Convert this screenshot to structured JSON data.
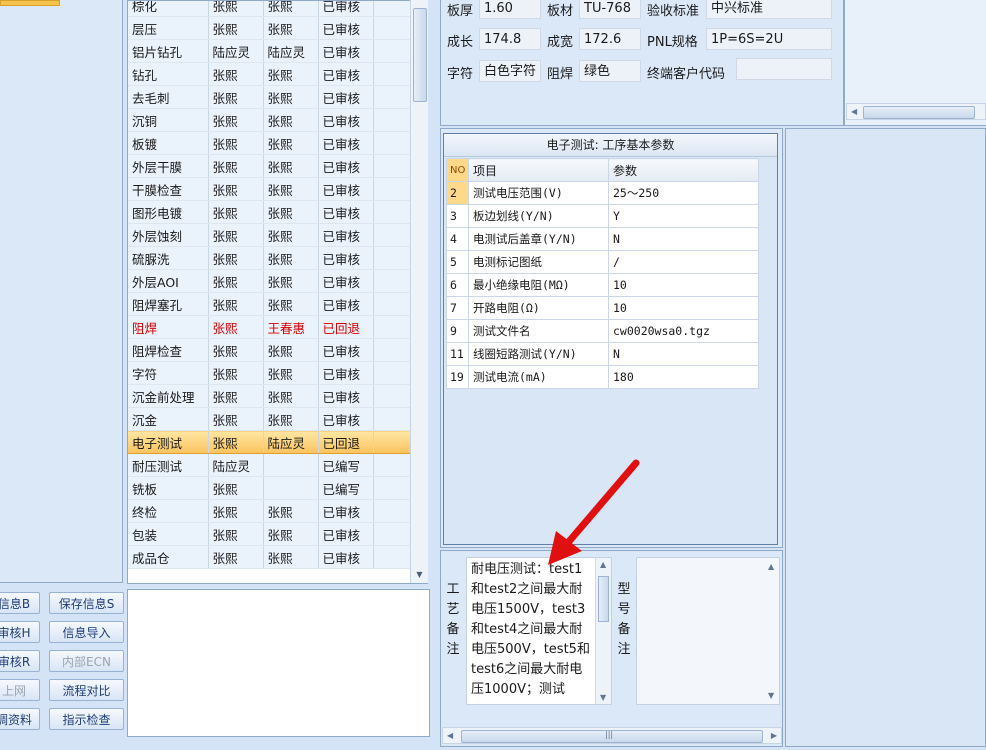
{
  "process_rows": [
    {
      "step": "棕化",
      "col2": "张熙",
      "col3": "张熙",
      "status": "已审核"
    },
    {
      "step": "层压",
      "col2": "张熙",
      "col3": "张熙",
      "status": "已审核"
    },
    {
      "step": "铝片钻孔",
      "col2": "陆应灵",
      "col3": "陆应灵",
      "status": "已审核"
    },
    {
      "step": "钻孔",
      "col2": "张熙",
      "col3": "张熙",
      "status": "已审核"
    },
    {
      "step": "去毛刺",
      "col2": "张熙",
      "col3": "张熙",
      "status": "已审核"
    },
    {
      "step": "沉铜",
      "col2": "张熙",
      "col3": "张熙",
      "status": "已审核"
    },
    {
      "step": "板镀",
      "col2": "张熙",
      "col3": "张熙",
      "status": "已审核"
    },
    {
      "step": "外层干膜",
      "col2": "张熙",
      "col3": "张熙",
      "status": "已审核"
    },
    {
      "step": "干膜检查",
      "col2": "张熙",
      "col3": "张熙",
      "status": "已审核"
    },
    {
      "step": "图形电镀",
      "col2": "张熙",
      "col3": "张熙",
      "status": "已审核"
    },
    {
      "step": "外层蚀刻",
      "col2": "张熙",
      "col3": "张熙",
      "status": "已审核"
    },
    {
      "step": "硫脲洗",
      "col2": "张熙",
      "col3": "张熙",
      "status": "已审核"
    },
    {
      "step": "外层AOI",
      "col2": "张熙",
      "col3": "张熙",
      "status": "已审核"
    },
    {
      "step": "阻焊塞孔",
      "col2": "张熙",
      "col3": "张熙",
      "status": "已审核"
    },
    {
      "step": "阻焊",
      "col2": "张熙",
      "col3": "王春惠",
      "status": "已回退"
    },
    {
      "step": "阻焊检查",
      "col2": "张熙",
      "col3": "张熙",
      "status": "已审核"
    },
    {
      "step": "字符",
      "col2": "张熙",
      "col3": "张熙",
      "status": "已审核"
    },
    {
      "step": "沉金前处理",
      "col2": "张熙",
      "col3": "张熙",
      "status": "已审核"
    },
    {
      "step": "沉金",
      "col2": "张熙",
      "col3": "张熙",
      "status": "已审核"
    },
    {
      "step": "电子测试",
      "col2": "张熙",
      "col3": "陆应灵",
      "status": "已回退"
    },
    {
      "step": "耐压测试",
      "col2": "陆应灵",
      "col3": "",
      "status": "已编写"
    },
    {
      "step": "铣板",
      "col2": "张熙",
      "col3": "",
      "status": "已编写"
    },
    {
      "step": "终检",
      "col2": "张熙",
      "col3": "张熙",
      "status": "已审核"
    },
    {
      "step": "包装",
      "col2": "张熙",
      "col3": "张熙",
      "status": "已审核"
    },
    {
      "step": "成品仓",
      "col2": "张熙",
      "col3": "张熙",
      "status": "已审核"
    }
  ],
  "buttons": {
    "info": "信息B",
    "save_info": "保存信息S",
    "review": "审核H",
    "import_info": "信息导入",
    "review2": "审核R",
    "internal_ecn": "内部ECN",
    "upload": "上网",
    "flow_compare": "流程对比",
    "adjust_data": "调资料",
    "instruction_check": "指示检查"
  },
  "info": {
    "thickness_label": "板厚",
    "thickness": "1.60",
    "material_label": "板材",
    "material": "TU-768",
    "standard_label": "验收标准",
    "standard": "中兴标准",
    "length_label": "成长",
    "length": "174.8",
    "width_label": "成宽",
    "width": "172.6",
    "pnl_label": "PNL规格",
    "pnl": "1P=6S=2U",
    "char_label": "字符",
    "char": "白色字符",
    "mask_label": "阻焊",
    "mask": "绿色",
    "client_code_label": "终端客户代码",
    "client_code": ""
  },
  "param_grid": {
    "title": "电子测试: 工序基本参数",
    "headers": {
      "no": "NO",
      "item": "项目",
      "param": "参数"
    },
    "rows": [
      {
        "no": "2",
        "item": "测试电压范围(V)",
        "param": "25～250"
      },
      {
        "no": "3",
        "item": "板边划线(Y/N)",
        "param": "Y"
      },
      {
        "no": "4",
        "item": "电测试后盖章(Y/N)",
        "param": "N"
      },
      {
        "no": "5",
        "item": "电测标记图纸",
        "param": "/"
      },
      {
        "no": "6",
        "item": "最小绝缘电阻(MΩ)",
        "param": "10"
      },
      {
        "no": "7",
        "item": "开路电阻(Ω)",
        "param": "10"
      },
      {
        "no": "9",
        "item": "测试文件名",
        "param": "cw0020wsa0.tgz"
      },
      {
        "no": "11",
        "item": "线圈短路测试(Y/N)",
        "param": "N"
      },
      {
        "no": "19",
        "item": "测试电流(mA)",
        "param": "180"
      }
    ]
  },
  "remark": {
    "process_label": "工艺备注",
    "model_label": "型号备注",
    "text": "耐电压测试：test1和test2之间最大耐电压1500V，test3和test4之间最大耐电压500V，test5和test6之间最大耐电压1000V；测试"
  },
  "colors": {
    "selected_row": "#f9c35e",
    "rollback_text": "#d40000",
    "arrow": "#e01010"
  },
  "icons": [
    "scroll-up-arrow-icon",
    "scroll-down-arrow-icon",
    "red-annotation-arrow-icon"
  ]
}
